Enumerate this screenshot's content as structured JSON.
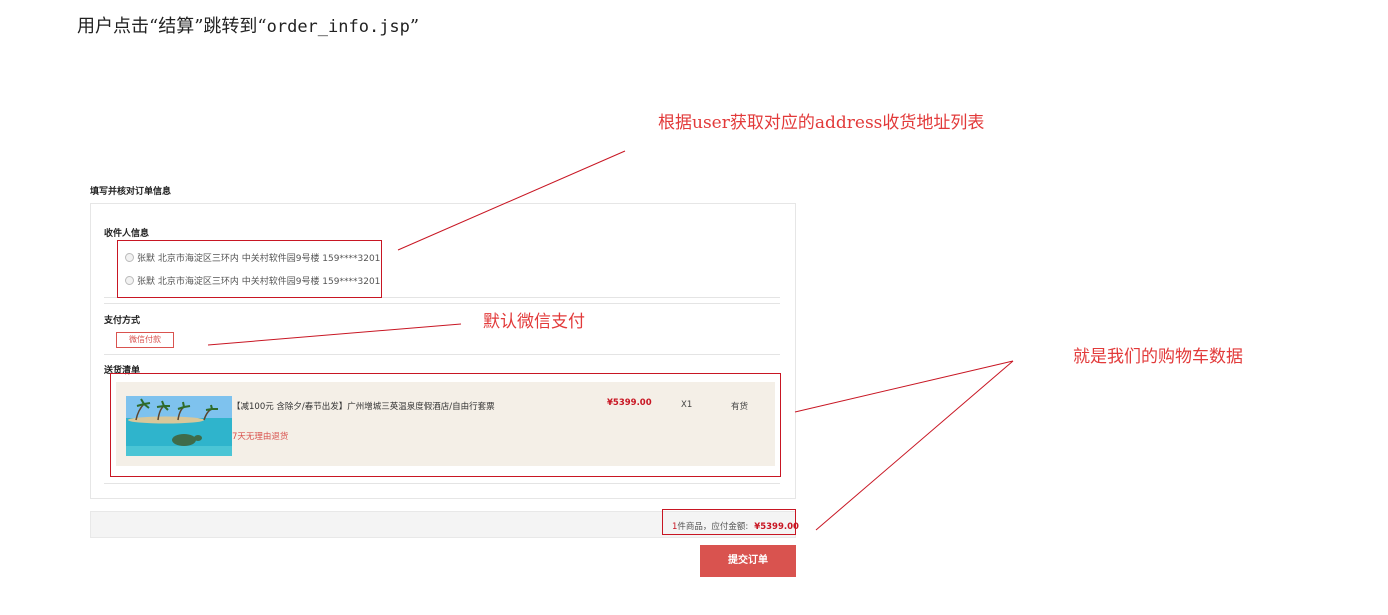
{
  "heading": {
    "prefix": "用户点击“结算”跳转到“",
    "code": "order_info.jsp",
    "suffix": "”"
  },
  "order": {
    "title": "填写并核对订单信息",
    "receiver": {
      "label": "收件人信息",
      "addresses": [
        "张默 北京市海淀区三环内 中关村软件园9号楼 159****3201",
        "张默 北京市海淀区三环内 中关村软件园9号楼 159****3201"
      ]
    },
    "payment": {
      "label": "支付方式",
      "option": "微信付款"
    },
    "goods": {
      "label": "送货清单",
      "item": {
        "name": "【减100元 含除夕/春节出发】广州增城三英温泉度假酒店/自由行套票",
        "return_policy": "7天无理由退货",
        "price": "¥5399.00",
        "quantity": "X1",
        "stock": "有货"
      }
    },
    "summary": {
      "count": "1",
      "count_suffix": "件商品，应付金额:",
      "amount": "¥5399.00"
    },
    "submit_label": "提交订单"
  },
  "annotations": {
    "address": "根据user获取对应的address收货地址列表",
    "payment": "默认微信支付",
    "cart": "就是我们的购物车数据"
  },
  "colors": {
    "accent": "#d9534f",
    "price": "#c81623",
    "annotation": "#e23a3a",
    "goods_bg": "#f4efe7"
  }
}
